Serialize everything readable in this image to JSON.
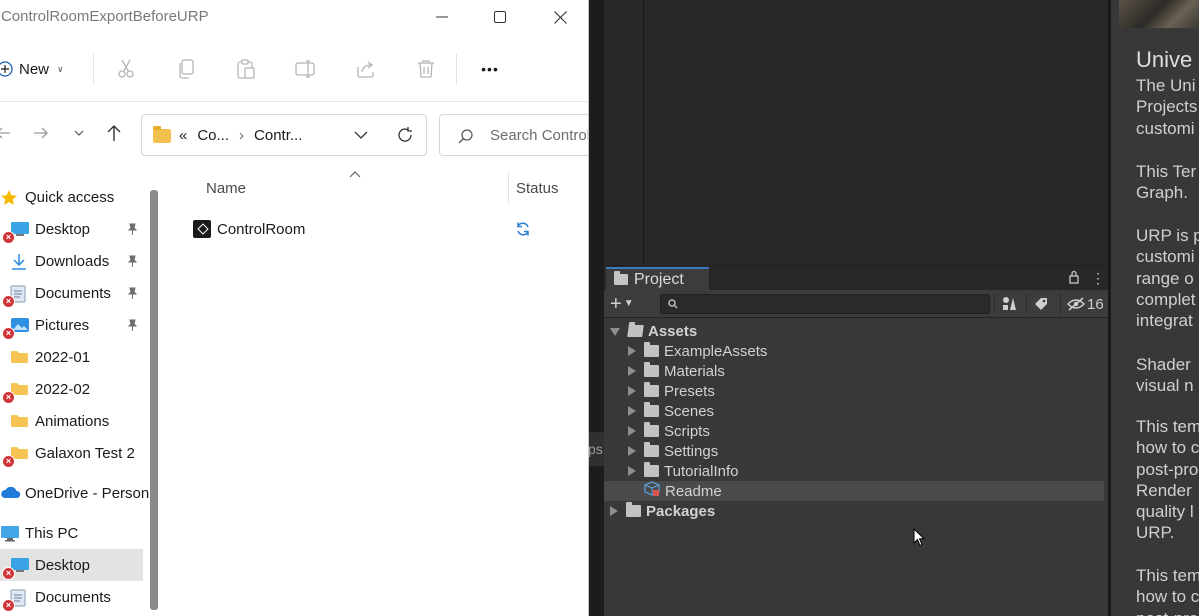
{
  "explorer": {
    "title": "ControlRoomExportBeforeURP",
    "commands": {
      "new_label": "New",
      "more_label": "•••"
    },
    "address": {
      "chevron": "«",
      "crumbs": [
        "Co...",
        "Contr..."
      ],
      "separator": "›"
    },
    "search_placeholder": "Search ControlRoom",
    "nav_items": [
      {
        "label": "Quick access",
        "icon": "star-icon"
      },
      {
        "label": "Desktop",
        "icon": "desktop-icon",
        "pinned": true,
        "error": true
      },
      {
        "label": "Downloads",
        "icon": "download-icon",
        "pinned": true
      },
      {
        "label": "Documents",
        "icon": "documents-icon",
        "pinned": true,
        "error": true
      },
      {
        "label": "Pictures",
        "icon": "pictures-icon",
        "pinned": true,
        "error": true
      },
      {
        "label": "2022-01",
        "icon": "folder-icon"
      },
      {
        "label": "2022-02",
        "icon": "folder-icon",
        "error": true
      },
      {
        "label": "Animations",
        "icon": "folder-icon"
      },
      {
        "label": "Galaxon Test 2",
        "icon": "folder-icon",
        "error": true
      },
      {
        "label": "OneDrive - Person",
        "icon": "onedrive-icon"
      },
      {
        "label": "This PC",
        "icon": "this-pc-icon"
      },
      {
        "label": "Desktop",
        "icon": "desktop-icon",
        "error": true,
        "selected": true
      },
      {
        "label": "Documents",
        "icon": "documents-icon",
        "error": true
      }
    ],
    "columns": {
      "name": "Name",
      "status": "Status"
    },
    "files": [
      {
        "name": "ControlRoom",
        "icon": "unity-icon",
        "status": "sync-pending-icon"
      }
    ]
  },
  "unity": {
    "strip_fragment": "ps",
    "project": {
      "tab_label": "Project",
      "hidden_packages_count": "16",
      "tree": [
        {
          "label": "Assets",
          "level": 0,
          "expanded": true,
          "bold": true
        },
        {
          "label": "ExampleAssets",
          "level": 1
        },
        {
          "label": "Materials",
          "level": 1
        },
        {
          "label": "Presets",
          "level": 1
        },
        {
          "label": "Scenes",
          "level": 1
        },
        {
          "label": "Scripts",
          "level": 1
        },
        {
          "label": "Settings",
          "level": 1
        },
        {
          "label": "TutorialInfo",
          "level": 1
        },
        {
          "label": "Readme",
          "level": 1,
          "asset": true,
          "selected": true
        },
        {
          "label": "Packages",
          "level": 0,
          "bold": true
        }
      ]
    },
    "inspector": {
      "title": "Unive",
      "paragraphs": [
        "The Uni\nProjects\ncustomi",
        "This Ter\nGraph.",
        "URP is p\ncustomi\nrange o\ncomplet\nintegrat",
        "Shader\nvisual n",
        "This tem\nhow to c\npost-pro\nRender\nquality l\nURP.",
        "This tem\nhow to c\npost-pro"
      ]
    }
  },
  "colors": {
    "unity_accent": "#3a79bb",
    "error_badge": "#d13438",
    "folder_yellow": "#f3c24e",
    "sync_blue": "#2b7fd6"
  }
}
